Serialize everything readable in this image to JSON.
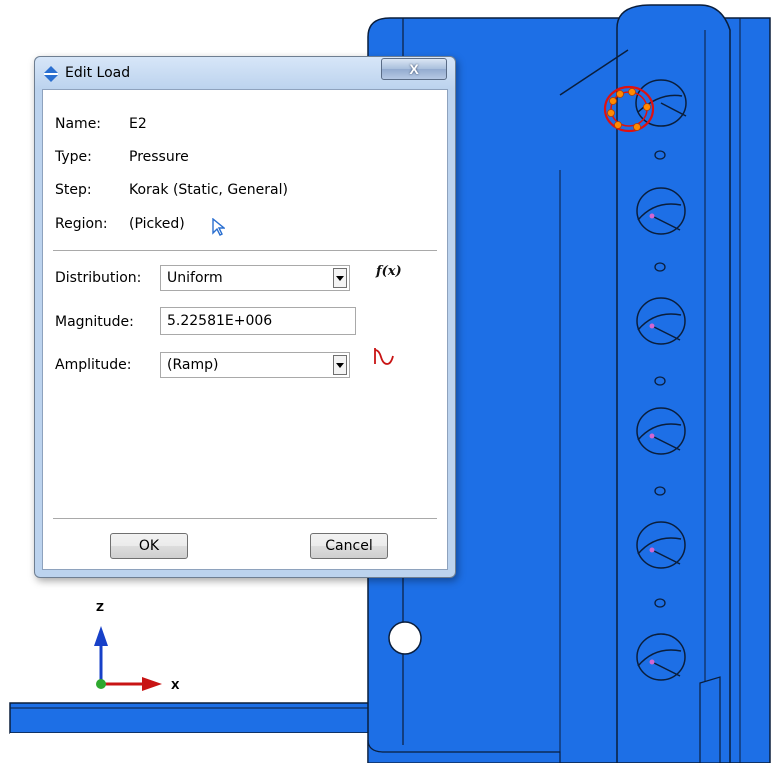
{
  "dialog": {
    "title": "Edit Load",
    "close_label": "X",
    "fields": {
      "name_label": "Name:",
      "name_value": "E2",
      "type_label": "Type:",
      "type_value": "Pressure",
      "step_label": "Step:",
      "step_value": "Korak (Static, General)",
      "region_label": "Region:",
      "region_value": "(Picked)"
    },
    "distribution": {
      "label": "Distribution:",
      "value": "Uniform"
    },
    "fx_label": "f(x)",
    "magnitude": {
      "label": "Magnitude:",
      "value": "5.22581E+006"
    },
    "amplitude": {
      "label": "Amplitude:",
      "value": "(Ramp)"
    },
    "ok_label": "OK",
    "cancel_label": "Cancel"
  },
  "triad": {
    "z_label": "Z",
    "x_label": "X"
  },
  "colors": {
    "model_blue": "#1d6fe6",
    "model_edge": "#0a1e3c",
    "selection_red": "#e01010",
    "node_orange": "#ff8a00",
    "triad_z": "#1740c8",
    "triad_x": "#c81414",
    "triad_origin": "#2ea82e"
  }
}
